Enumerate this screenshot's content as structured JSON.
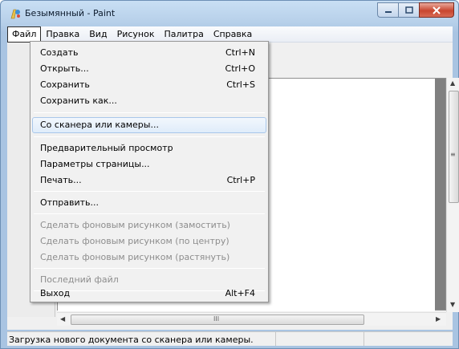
{
  "window": {
    "title": "Безымянный - Paint",
    "icon": "paint-palette-icon"
  },
  "caption_buttons": {
    "minimize_icon": "minimize-icon",
    "maximize_icon": "maximize-icon",
    "close_icon": "close-icon"
  },
  "menubar": {
    "items": [
      {
        "label": "Файл",
        "active": true
      },
      {
        "label": "Правка"
      },
      {
        "label": "Вид"
      },
      {
        "label": "Рисунок"
      },
      {
        "label": "Палитра"
      },
      {
        "label": "Справка"
      }
    ]
  },
  "file_menu": {
    "items": [
      {
        "label": "Создать",
        "shortcut": "Ctrl+N"
      },
      {
        "label": "Открыть...",
        "shortcut": "Ctrl+O"
      },
      {
        "label": "Сохранить",
        "shortcut": "Ctrl+S"
      },
      {
        "label": "Сохранить как...",
        "shortcut": ""
      },
      {
        "label": "Со сканера или камеры...",
        "shortcut": "",
        "highlighted": true
      },
      {
        "label": "Предварительный просмотр",
        "shortcut": ""
      },
      {
        "label": "Параметры страницы...",
        "shortcut": ""
      },
      {
        "label": "Печать...",
        "shortcut": "Ctrl+P"
      },
      {
        "label": "Отправить...",
        "shortcut": ""
      },
      {
        "label": "Сделать фоновым рисунком (замостить)",
        "shortcut": "",
        "disabled": true
      },
      {
        "label": "Сделать фоновым рисунком (по центру)",
        "shortcut": "",
        "disabled": true
      },
      {
        "label": "Сделать фоновым рисунком (растянуть)",
        "shortcut": "",
        "disabled": true
      },
      {
        "label": "Последний файл",
        "shortcut": "",
        "disabled": true
      },
      {
        "label": "Выход",
        "shortcut": "Alt+F4"
      }
    ]
  },
  "scrollbars": {
    "h_thumb_grip": "III",
    "v_thumb_grip": "≡"
  },
  "statusbar": {
    "text": "Загрузка нового документа со сканера или камеры."
  },
  "colors": {
    "titlebar": "#b6cfe9",
    "close_button": "#c8452e",
    "menu_highlight": "#dfecfa",
    "disabled_text": "#8d8d8d"
  }
}
